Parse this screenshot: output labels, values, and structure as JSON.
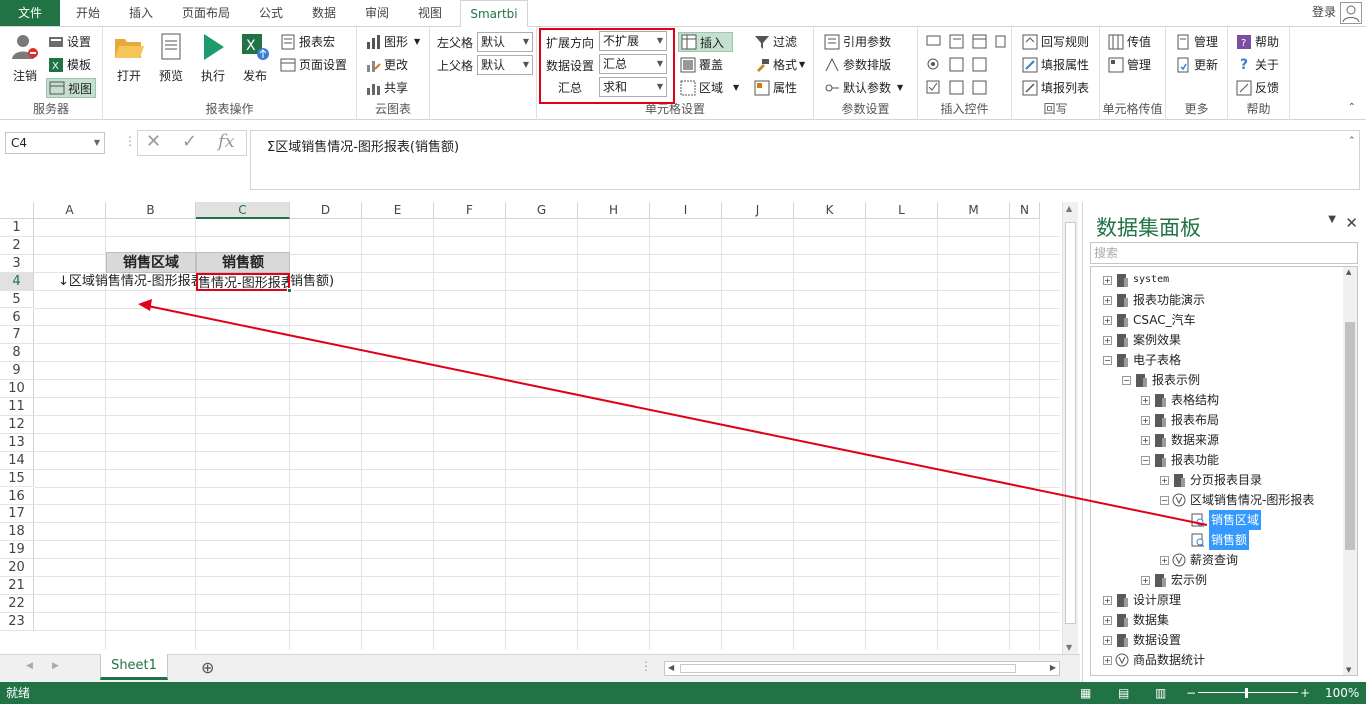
{
  "tabs": [
    "文件",
    "开始",
    "插入",
    "页面布局",
    "公式",
    "数据",
    "审阅",
    "视图",
    "Smartbi"
  ],
  "login": "登录",
  "ribbon": {
    "server": {
      "label": "服务器",
      "logout": "注销",
      "settings": "设置",
      "template": "模板",
      "view": "视图"
    },
    "report_ops": {
      "label": "报表操作",
      "open": "打开",
      "preview": "预览",
      "execute": "执行",
      "publish": "发布",
      "macro": "报表宏",
      "page_setup": "页面设置"
    },
    "cloud_chart": {
      "label": "云图表",
      "chart": "图形",
      "modify": "更改",
      "share": "共享"
    },
    "parent": {
      "left_label": "左父格",
      "left_value": "默认",
      "top_label": "上父格",
      "top_value": "默认"
    },
    "cell_settings": {
      "label": "单元格设置",
      "expand_dir_label": "扩展方向",
      "expand_dir_value": "不扩展",
      "data_setting_label": "数据设置",
      "data_setting_value": "汇总",
      "summary_label": "汇总",
      "summary_value": "求和",
      "insert": "插入",
      "cover": "覆盖",
      "area": "区域"
    },
    "misc": {
      "filter": "过滤",
      "format": "格式",
      "property": "属性"
    },
    "params": {
      "label": "参数设置",
      "ref": "引用参数",
      "layout": "参数排版",
      "default": "默认参数"
    },
    "controls": {
      "label": "插入控件"
    },
    "writeback": {
      "label": "回写",
      "rules": "回写规则",
      "fill_prop": "填报属性",
      "fill_list": "填报列表"
    },
    "passvalue": {
      "label": "单元格传值",
      "pass": "传值",
      "manage": "管理"
    },
    "more": {
      "label": "更多",
      "manage": "管理",
      "update": "更新"
    },
    "help": {
      "label": "帮助",
      "help": "帮助",
      "about": "关于",
      "feedback": "反馈"
    }
  },
  "formula_bar": {
    "name_box": "C4",
    "formula": "Σ区域销售情况-图形报表(销售额)"
  },
  "grid": {
    "columns": [
      "A",
      "B",
      "C",
      "D",
      "E",
      "F",
      "G",
      "H",
      "I",
      "J",
      "K",
      "L",
      "M",
      "N"
    ],
    "rows": [
      "1",
      "2",
      "3",
      "4",
      "5",
      "6",
      "7",
      "8",
      "9",
      "10",
      "11",
      "12",
      "13",
      "14",
      "15",
      "16",
      "17",
      "18",
      "19",
      "20",
      "21",
      "22",
      "23"
    ],
    "b3": "销售区域",
    "c3": "销售额",
    "b4": "↓区域销售情况-图形报表(销",
    "c4": "售情况-图形报表",
    "d4": "销售额)"
  },
  "sheet": {
    "tab": "Sheet1",
    "add": "⊕"
  },
  "status": {
    "text": "就绪",
    "zoom": "100%"
  },
  "panel": {
    "title": "数据集面板",
    "search_placeholder": "搜索",
    "tree": [
      {
        "label": "system",
        "mono": true
      },
      {
        "label": "报表功能演示"
      },
      {
        "label": "CSAC_汽车"
      },
      {
        "label": "案例效果"
      },
      {
        "label": "电子表格"
      },
      {
        "label": "报表示例"
      },
      {
        "label": "表格结构"
      },
      {
        "label": "报表布局"
      },
      {
        "label": "数据来源"
      },
      {
        "label": "报表功能"
      },
      {
        "label": "分页报表目录"
      },
      {
        "label": "区域销售情况-图形报表"
      },
      {
        "label": "销售区域"
      },
      {
        "label": "销售额"
      },
      {
        "label": "薪资查询"
      },
      {
        "label": "宏示例"
      },
      {
        "label": "设计原理"
      },
      {
        "label": "数据集"
      },
      {
        "label": "数据设置"
      },
      {
        "label": "商品数据统计"
      }
    ]
  },
  "colors": {
    "accent": "#217346",
    "highlight": "#e0001a",
    "selection": "#3399ff"
  }
}
